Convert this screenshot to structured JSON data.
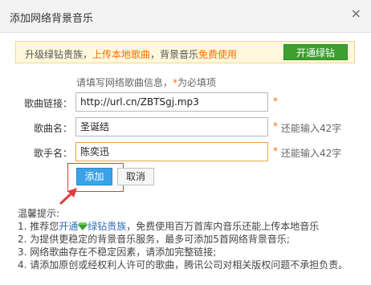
{
  "dialog": {
    "title": "添加网络背景音乐",
    "close_icon": "close-icon"
  },
  "promo": {
    "text_a": "升级绿钻贵族，",
    "text_b": "上传本地歌曲",
    "text_c": "，背景音乐",
    "text_d": "免费使用",
    "button": "开通绿钻"
  },
  "form": {
    "note_a": "请填写网络歌曲信息，",
    "note_star": "*",
    "note_b": "为必填项",
    "link_label": "歌曲链接：",
    "link_value": "http://url.cn/ZBTSgj.mp3",
    "song_label": "歌曲名：",
    "song_value": "圣诞结",
    "song_remaining": "还能输入42字",
    "singer_label": "歌手名：",
    "singer_value": "陈奕迅",
    "singer_remaining": "还能输入42字",
    "required_mark": "*"
  },
  "buttons": {
    "add": "添加",
    "cancel": "取消"
  },
  "tips": {
    "heading": "温馨提示:",
    "line1_a": "1. 推荐您",
    "line1_link": "开通",
    "line1_green": "绿钻贵族",
    "line1_b": "，免费使用百万首库内音乐还能上传本地音乐",
    "line2": "2. 为提供更稳定的背景音乐服务，最多可添加5首网络背景音乐;",
    "line3": "3. 网络歌曲存在不稳定因素，请添加完整链接;",
    "line4": "4. 请添加原创或经权利人许可的歌曲，腾讯公司对相关版权问题不承担负责。"
  },
  "colors": {
    "accent_orange": "#ff6a00",
    "green_button": "#3ca02f",
    "add_button_blue": "#3ba1e8",
    "highlight_red": "#e03c3c"
  }
}
